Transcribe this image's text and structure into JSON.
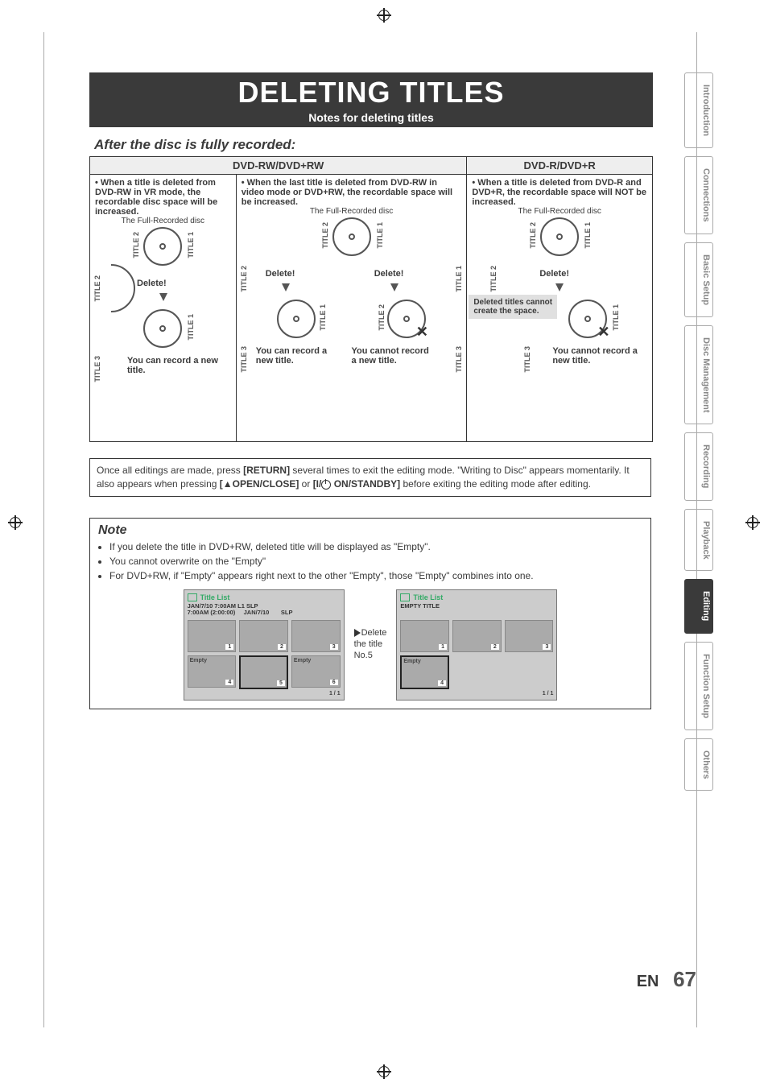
{
  "page": {
    "title": "DELETING TITLES",
    "subtitle": "Notes for deleting titles",
    "section_heading": "After the disc is fully recorded:",
    "language": "EN",
    "number": "67"
  },
  "tableHeaders": {
    "rw": "DVD-RW/DVD+RW",
    "r": "DVD-R/DVD+R"
  },
  "cells": {
    "c1": {
      "bullet": "• When a title is deleted from DVD-RW in VR mode, the recordable disc space will be increased.",
      "caption": "The Full-Recorded disc",
      "t1": "TITLE 1",
      "t2": "TITLE 2",
      "t3": "TITLE 3",
      "del": "Delete!",
      "result": "You can record a new title."
    },
    "c2": {
      "bullet": "• When the last title is deleted from DVD-RW in video mode or DVD+RW, the recordable space will be increased.",
      "caption": "The Full-Recorded disc",
      "t1": "TITLE 1",
      "t2": "TITLE 2",
      "t3": "TITLE 3",
      "delA": "Delete!",
      "delB": "Delete!",
      "resA": "You can record a new title.",
      "resB": "You cannot record a new title."
    },
    "c3": {
      "bullet": "• When a title is deleted from DVD-R and DVD+R, the recordable space will NOT be increased.",
      "caption": "The Full-Recorded disc",
      "t1": "TITLE 1",
      "t2": "TITLE 2",
      "t3": "TITLE 3",
      "del": "Delete!",
      "grey": "Deleted titles cannot create the space.",
      "result": "You cannot record a new title."
    }
  },
  "returnBox": {
    "p1a": "Once all editings are made, press ",
    "p1btn": "[RETURN]",
    "p1b": " several times to exit the editing mode. \"Writing to Disc\" appears momentarily. It also appears when pressing ",
    "open": "OPEN/CLOSE]",
    "or": " or ",
    "standby": "[I/",
    "standby2": " ON/STANDBY]",
    "p1c": " before exiting the editing mode after editing."
  },
  "note": {
    "heading": "Note",
    "items": [
      "If you delete the title in DVD+RW, deleted title will be displayed as \"Empty\".",
      "You cannot overwrite on the \"Empty\"",
      "For DVD+RW, if \"Empty\" appears right next to the other \"Empty\", those \"Empty\" combines into one."
    ],
    "arrow_caption_line1": "Delete",
    "arrow_caption_line2": "the title",
    "arrow_caption_line3": "No.5"
  },
  "titleList1": {
    "header": "Title List",
    "line1": "JAN/7/10  7:00AM  L1  SLP",
    "line2a": "7:00AM (2:00:00)",
    "line2b": "JAN/7/10",
    "line2c": "SLP",
    "tiles": [
      {
        "num": "1",
        "empty": false,
        "sel": false
      },
      {
        "num": "2",
        "empty": false,
        "sel": false
      },
      {
        "num": "3",
        "empty": false,
        "sel": false
      },
      {
        "num": "4",
        "empty": true,
        "sel": false
      },
      {
        "num": "5",
        "empty": false,
        "sel": true
      },
      {
        "num": "6",
        "empty": true,
        "sel": false
      }
    ],
    "footer": "1 / 1"
  },
  "titleList2": {
    "header": "Title List",
    "line1": "EMPTY TITLE",
    "tiles": [
      {
        "num": "1",
        "empty": false,
        "sel": false
      },
      {
        "num": "2",
        "empty": false,
        "sel": false
      },
      {
        "num": "3",
        "empty": false,
        "sel": false
      },
      {
        "num": "4",
        "empty": true,
        "sel": true
      },
      {
        "num": "",
        "empty": false,
        "sel": false,
        "blank": true
      },
      {
        "num": "",
        "empty": false,
        "sel": false,
        "blank": true
      }
    ],
    "footer": "1 / 1",
    "emptyLabel": "Empty"
  },
  "tabs": [
    {
      "label": "Introduction",
      "active": false
    },
    {
      "label": "Connections",
      "active": false
    },
    {
      "label": "Basic Setup",
      "active": false
    },
    {
      "label": "Disc\nManagement",
      "active": false
    },
    {
      "label": "Recording",
      "active": false
    },
    {
      "label": "Playback",
      "active": false
    },
    {
      "label": "Editing",
      "active": true
    },
    {
      "label": "Function Setup",
      "active": false
    },
    {
      "label": "Others",
      "active": false
    }
  ]
}
